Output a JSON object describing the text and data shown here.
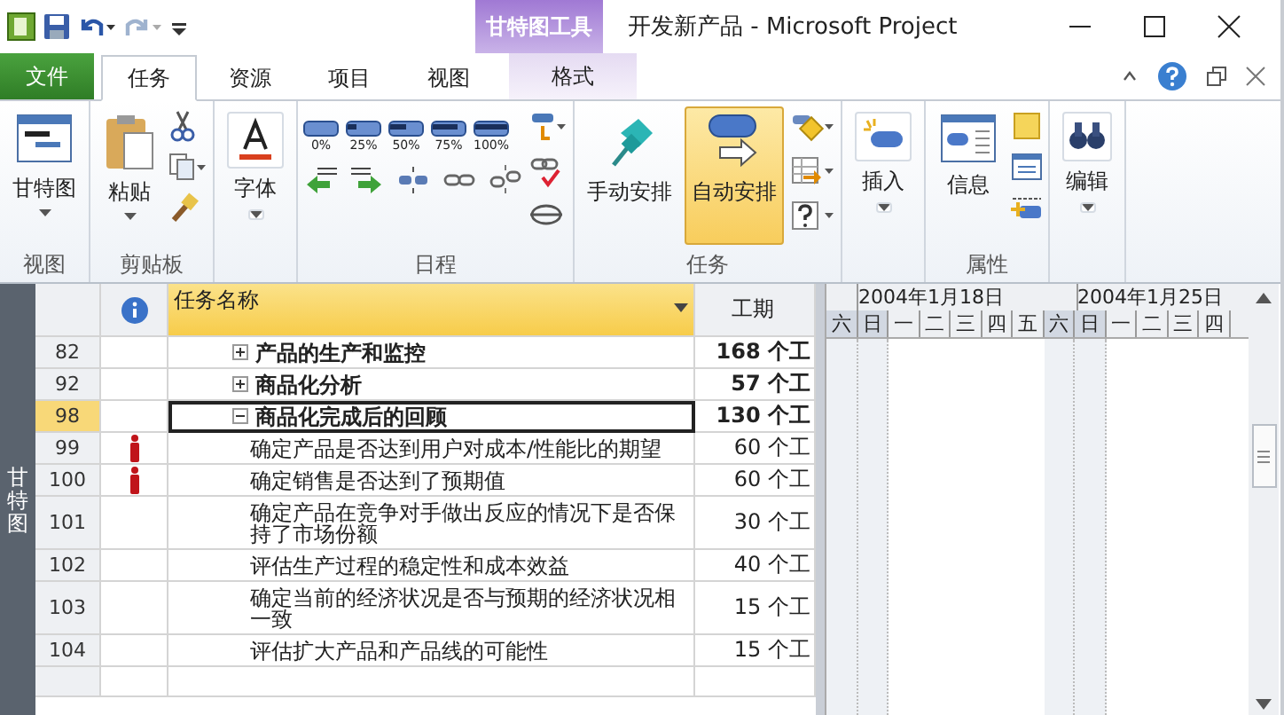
{
  "title_bar": {
    "contextual_tab": "甘特图工具",
    "title": "开发新产品 - Microsoft Project"
  },
  "tabs": [
    {
      "label": "文件",
      "kind": "file",
      "selected": false
    },
    {
      "label": "任务",
      "kind": "normal",
      "selected": true
    },
    {
      "label": "资源",
      "kind": "normal",
      "selected": false
    },
    {
      "label": "项目",
      "kind": "normal",
      "selected": false
    },
    {
      "label": "视图",
      "kind": "normal",
      "selected": false
    },
    {
      "label": "格式",
      "kind": "contextual",
      "selected": false
    }
  ],
  "ribbon_groups": [
    {
      "kind": "view",
      "label": "视图",
      "buttons": [
        {
          "label": "甘特图",
          "selected": false
        }
      ]
    },
    {
      "kind": "clipboard",
      "label": "剪贴板",
      "buttons": [
        {
          "label": "粘贴",
          "selected": false
        }
      ]
    },
    {
      "kind": "font",
      "buttons": [
        {
          "label": "字体",
          "selected": false
        }
      ]
    },
    {
      "kind": "schedule",
      "label": "日程",
      "percent_labels": [
        "0%",
        "25%",
        "50%",
        "75%",
        "100%"
      ]
    },
    {
      "kind": "tasks",
      "label": "任务",
      "buttons": [
        {
          "label": "手动安排",
          "selected": false
        },
        {
          "label": "自动安排",
          "selected": true
        }
      ]
    },
    {
      "kind": "insert",
      "buttons": [
        {
          "label": "插入",
          "selected": false
        }
      ]
    },
    {
      "kind": "properties",
      "label": "属性",
      "buttons": [
        {
          "label": "信息",
          "selected": false
        }
      ]
    },
    {
      "kind": "editing",
      "buttons": [
        {
          "label": "编辑",
          "selected": false
        }
      ]
    }
  ],
  "view_bar": {
    "label": "甘特图"
  },
  "table": {
    "columns": [
      "任务名称",
      "工期"
    ],
    "rows": [
      {
        "id": "82",
        "name": "产品的生产和监控",
        "duration": "168 个工",
        "summary": true,
        "expanded": false,
        "selected": false,
        "indicator": false
      },
      {
        "id": "92",
        "name": "商品化分析",
        "duration": "57 个工",
        "summary": true,
        "expanded": false,
        "selected": false,
        "indicator": false
      },
      {
        "id": "98",
        "name": "商品化完成后的回顾",
        "duration": "130 个工",
        "summary": true,
        "expanded": true,
        "selected": true,
        "indicator": false,
        "children": [
          {
            "id": "99",
            "name": "确定产品是否达到用户对成本/性能比的期望",
            "duration": "60 个工",
            "summary": false,
            "selected": false,
            "indicator": true
          },
          {
            "id": "100",
            "name": "确定销售是否达到了预期值",
            "duration": "60 个工",
            "summary": false,
            "selected": false,
            "indicator": true
          },
          {
            "id": "101",
            "name": "确定产品在竞争对手做出反应的情况下是否保持了市场份额",
            "duration": "30 个工",
            "summary": false,
            "selected": false,
            "indicator": false
          },
          {
            "id": "102",
            "name": "评估生产过程的稳定性和成本效益",
            "duration": "40 个工",
            "summary": false,
            "selected": false,
            "indicator": false
          },
          {
            "id": "103",
            "name": "确定当前的经济状况是否与预期的经济状况相一致",
            "duration": "15 个工",
            "summary": false,
            "selected": false,
            "indicator": false
          },
          {
            "id": "104",
            "name": "评估扩大产品和产品线的可能性",
            "duration": "15 个工",
            "summary": false,
            "selected": false,
            "indicator": false
          }
        ]
      }
    ]
  },
  "timescale": {
    "weeks": [
      "2004年1月18日",
      "2004年1月25日"
    ],
    "days": [
      {
        "label": "六",
        "nonworking": true
      },
      {
        "label": "日",
        "nonworking": true
      },
      {
        "label": "一",
        "nonworking": false
      },
      {
        "label": "二",
        "nonworking": false
      },
      {
        "label": "三",
        "nonworking": false
      },
      {
        "label": "四",
        "nonworking": false
      },
      {
        "label": "五",
        "nonworking": false
      },
      {
        "label": "六",
        "nonworking": true
      },
      {
        "label": "日",
        "nonworking": true
      },
      {
        "label": "一",
        "nonworking": false
      },
      {
        "label": "二",
        "nonworking": false
      },
      {
        "label": "三",
        "nonworking": false
      },
      {
        "label": "四",
        "nonworking": false
      }
    ]
  }
}
